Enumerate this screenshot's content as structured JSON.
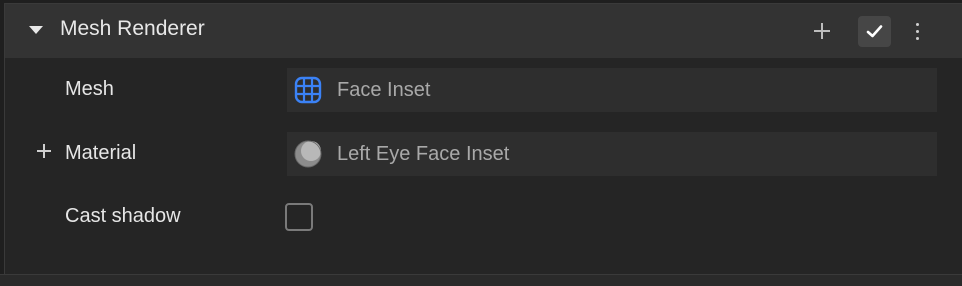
{
  "component": {
    "title": "Mesh Renderer",
    "enabled": true,
    "icons": {
      "collapse": "caret-down-icon",
      "add": "plus-icon",
      "enabled": "checkmark-icon",
      "more": "more-vertical-icon"
    }
  },
  "properties": {
    "mesh": {
      "label": "Mesh",
      "value": "Face Inset",
      "icon": "mesh-grid-icon",
      "icon_color": "#3b82f6"
    },
    "material": {
      "label": "Material",
      "value": "Left Eye Face Inset",
      "icon": "material-sphere-icon",
      "add_icon": "plus-icon"
    },
    "cast_shadow": {
      "label": "Cast shadow",
      "checked": false
    }
  },
  "colors": {
    "header_bg": "#333333",
    "panel_bg": "#252525",
    "field_bg": "#2e2e2e",
    "accent": "#3b82f6"
  }
}
